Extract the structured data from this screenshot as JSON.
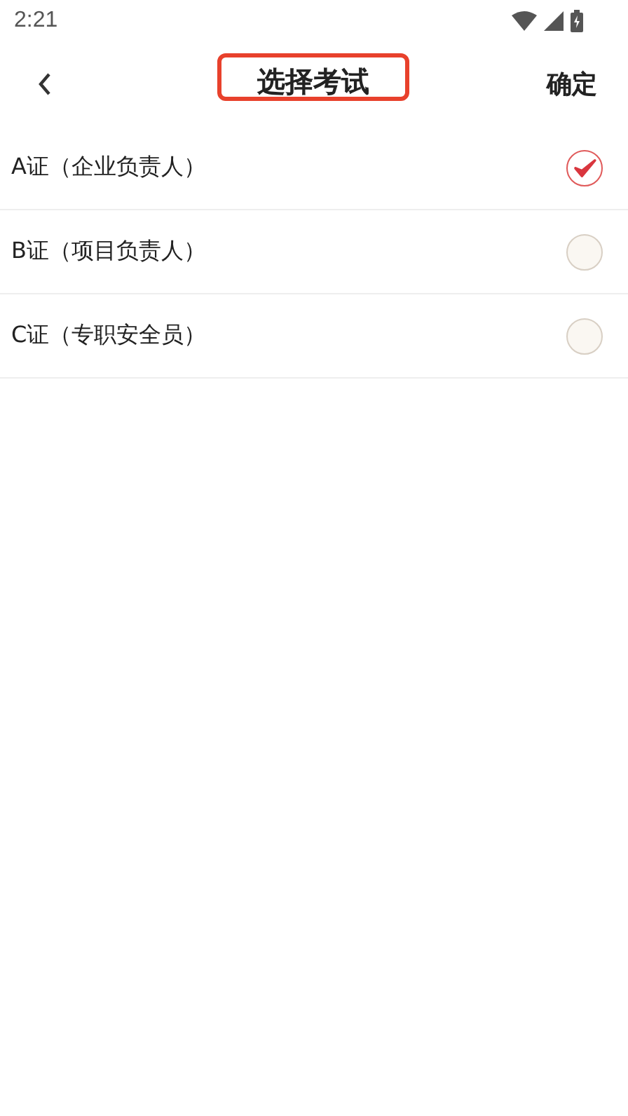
{
  "status_bar": {
    "time": "2:21"
  },
  "header": {
    "title": "选择考试",
    "title_highlighted": true,
    "confirm": "确定"
  },
  "options": [
    {
      "label": "A证（企业负责人）",
      "selected": true
    },
    {
      "label": "B证（项目负责人）",
      "selected": false
    },
    {
      "label": "C证（专职安全员）",
      "selected": false
    }
  ]
}
